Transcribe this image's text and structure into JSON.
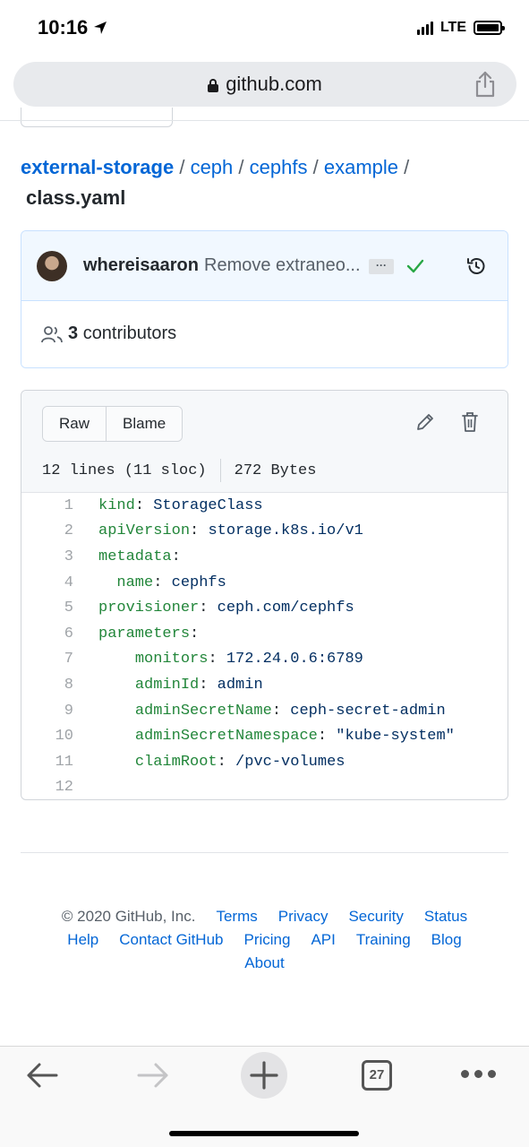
{
  "status_bar": {
    "time": "10:16",
    "network": "LTE",
    "location_icon": "location-arrow-icon"
  },
  "browser": {
    "url": "github.com",
    "open_tabs": "27"
  },
  "breadcrumb": {
    "repo": "external-storage",
    "sep": "/",
    "parts": [
      "ceph",
      "cephfs",
      "example"
    ],
    "file": "class.yaml"
  },
  "commit": {
    "author": "whereisaaron",
    "message": "Remove extraneo...",
    "ellipsis": "···",
    "contributors_count": "3",
    "contributors_label": "contributors"
  },
  "file": {
    "buttons": [
      "Raw",
      "Blame"
    ],
    "lines_info": "12 lines (11 sloc)",
    "size": "272 Bytes",
    "code": [
      {
        "n": "1",
        "indent": "",
        "key": "kind",
        "value": "StorageClass"
      },
      {
        "n": "2",
        "indent": "",
        "key": "apiVersion",
        "value": "storage.k8s.io/v1"
      },
      {
        "n": "3",
        "indent": "",
        "key": "metadata",
        "value": ""
      },
      {
        "n": "4",
        "indent": "  ",
        "key": "name",
        "value": "cephfs"
      },
      {
        "n": "5",
        "indent": "",
        "key": "provisioner",
        "value": "ceph.com/cephfs"
      },
      {
        "n": "6",
        "indent": "",
        "key": "parameters",
        "value": ""
      },
      {
        "n": "7",
        "indent": "    ",
        "key": "monitors",
        "value": "172.24.0.6:6789"
      },
      {
        "n": "8",
        "indent": "    ",
        "key": "adminId",
        "value": "admin"
      },
      {
        "n": "9",
        "indent": "    ",
        "key": "adminSecretName",
        "value": "ceph-secret-admin"
      },
      {
        "n": "10",
        "indent": "    ",
        "key": "adminSecretNamespace",
        "value": "\"kube-system\""
      },
      {
        "n": "11",
        "indent": "    ",
        "key": "claimRoot",
        "value": "/pvc-volumes"
      },
      {
        "n": "12",
        "indent": "",
        "key": "",
        "value": ""
      }
    ]
  },
  "footer": {
    "copyright": "© 2020 GitHub, Inc.",
    "links_row1": [
      "Terms",
      "Privacy",
      "Security",
      "Status"
    ],
    "links_row2": [
      "Help",
      "Contact GitHub",
      "Pricing",
      "API",
      "Training",
      "Blog"
    ],
    "links_row3": [
      "About"
    ]
  },
  "colors": {
    "link": "#0366d6",
    "yaml_key": "#22863a",
    "yaml_value": "#032f62",
    "success": "#28a745"
  }
}
